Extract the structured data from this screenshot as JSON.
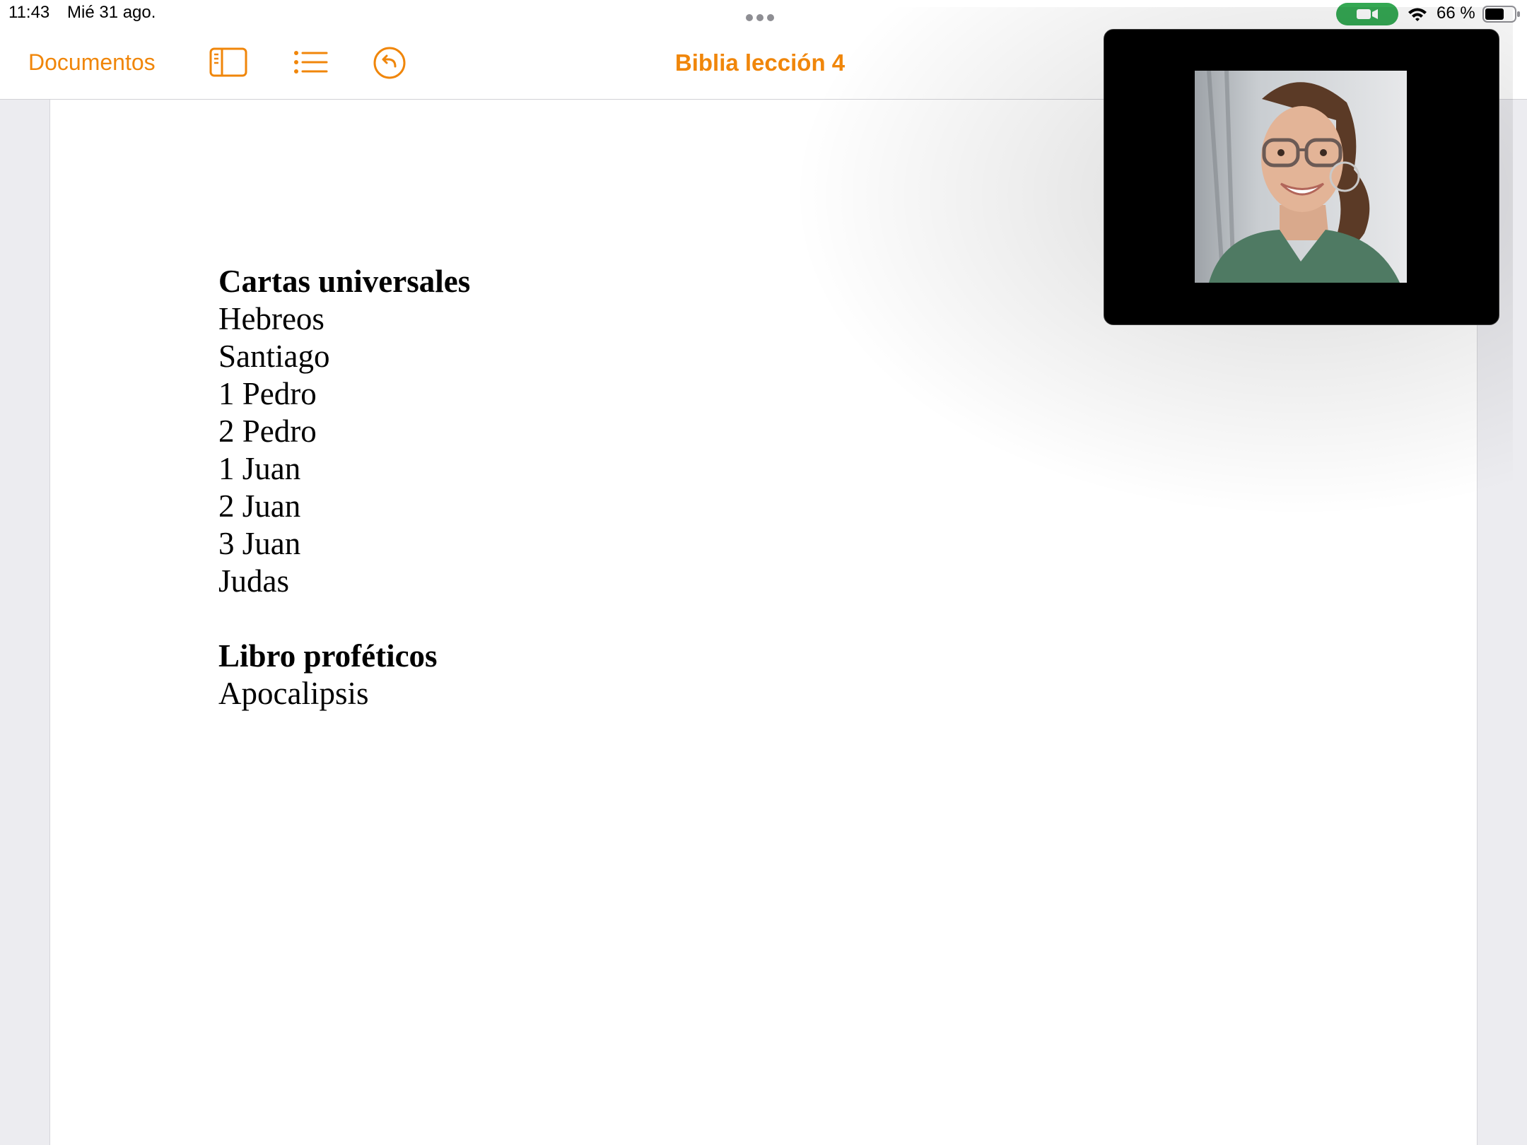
{
  "status_bar": {
    "time": "11:43",
    "date": "Mié 31 ago.",
    "battery_percent": "66 %",
    "battery_level": 0.66
  },
  "toolbar": {
    "back_label": "Documentos",
    "title": "Biblia lección 4",
    "accent_color": "#f0860a",
    "icons": [
      "sidebar-icon",
      "list-icon",
      "undo-icon"
    ]
  },
  "document": {
    "section1": {
      "heading": "Cartas universales",
      "items": [
        "Hebreos",
        "Santiago",
        "1 Pedro",
        "2 Pedro",
        "1 Juan",
        "2 Juan",
        "3 Juan",
        "Judas"
      ]
    },
    "section2": {
      "heading": "Libro proféticos",
      "items": [
        "Apocalipsis"
      ]
    }
  },
  "video_call": {
    "state": "picture-in-picture"
  }
}
